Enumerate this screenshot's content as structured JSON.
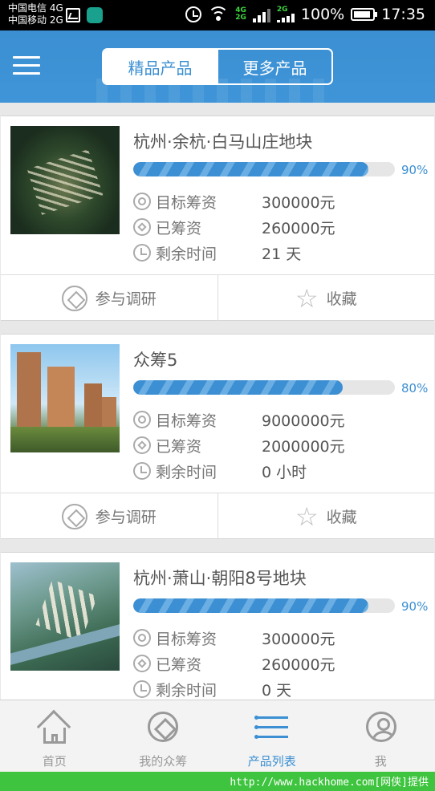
{
  "status_bar": {
    "carrier_1": "中国电信 4G",
    "carrier_2": "中国移动 2G",
    "net_top": "4G",
    "net_bottom": "2G",
    "net_right": "2G",
    "battery": "100%",
    "time": "17:35"
  },
  "header": {
    "tabs": [
      {
        "label": "精品产品",
        "active": true
      },
      {
        "label": "更多产品",
        "active": false
      }
    ]
  },
  "labels": {
    "target": "目标筹资",
    "raised": "已筹资",
    "remaining": "剩余时间",
    "participate": "参与调研",
    "favorite": "收藏"
  },
  "products": [
    {
      "title": "杭州·余杭·白马山庄地块",
      "progress": 0.9,
      "progress_label": "90%",
      "target": "300000元",
      "raised": "260000元",
      "remaining": "21 天"
    },
    {
      "title": "众筹5",
      "progress": 0.8,
      "progress_label": "80%",
      "target": "9000000元",
      "raised": "2000000元",
      "remaining": "0 小时"
    },
    {
      "title": "杭州·萧山·朝阳8号地块",
      "progress": 0.9,
      "progress_label": "90%",
      "target": "300000元",
      "raised": "260000元",
      "remaining": "0 天"
    }
  ],
  "bottom_nav": [
    {
      "label": "首页",
      "icon": "home-icon",
      "active": false
    },
    {
      "label": "我的众筹",
      "icon": "my-crowdfunding-icon",
      "active": false
    },
    {
      "label": "产品列表",
      "icon": "product-list-icon",
      "active": true
    },
    {
      "label": "我",
      "icon": "profile-icon",
      "active": false
    }
  ],
  "watermark": "http://www.hackhome.com[网侠]提供",
  "colors": {
    "accent": "#3b8fd2",
    "watermark": "#3ec43e"
  }
}
